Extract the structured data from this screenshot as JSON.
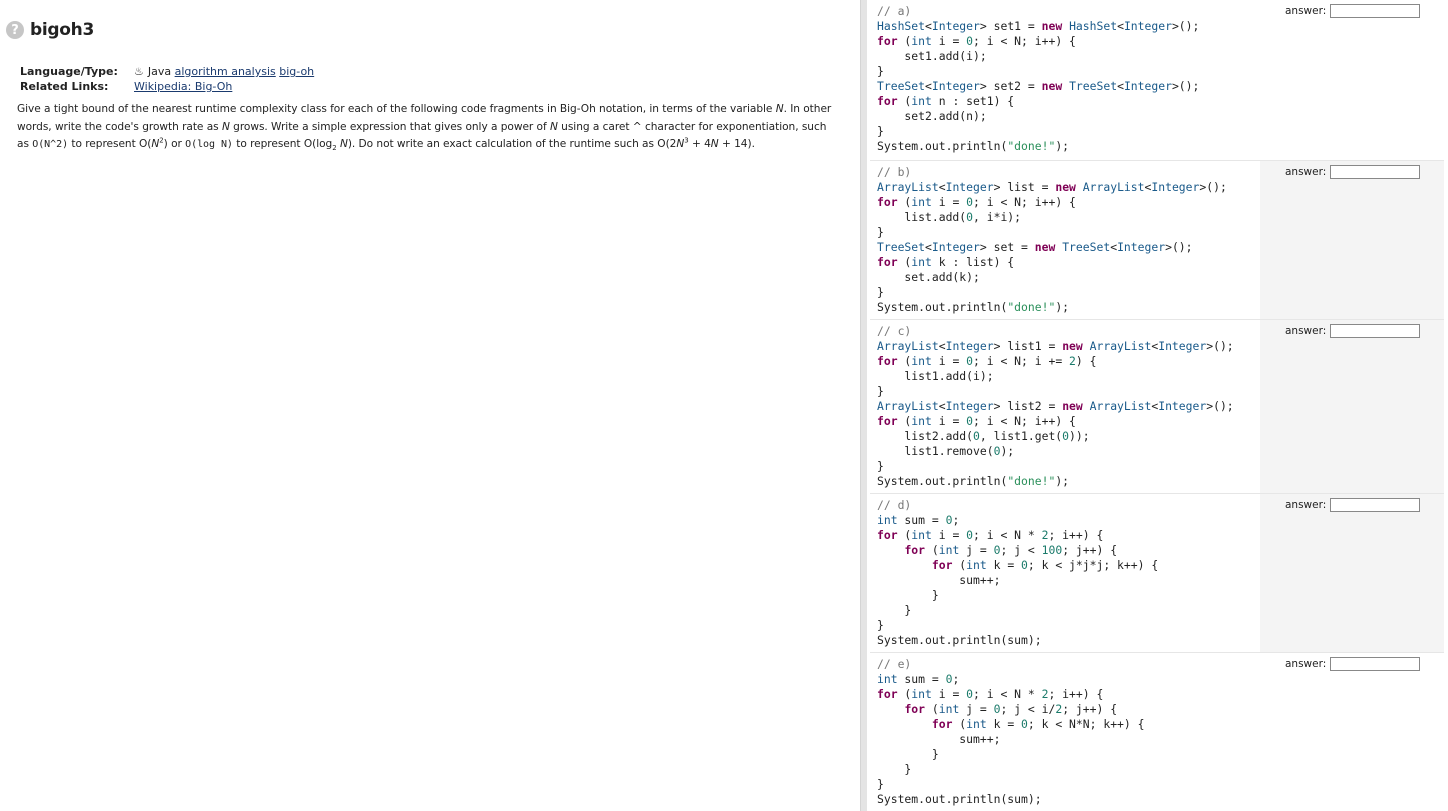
{
  "page": {
    "title": "bigoh3",
    "meta": {
      "language_label": "Language/Type:",
      "language_value": "Java",
      "tag1": "algorithm analysis",
      "tag2": "big-oh",
      "links_label": "Related Links:",
      "link1": "Wikipedia: Big-Oh"
    },
    "description": {
      "p1": "Give a tight bound of the nearest runtime complexity class for each of the following code fragments in Big-Oh notation, in terms of the variable ",
      "var_n": "N",
      "p2": ". In other words, write the code's growth rate as ",
      "p3": " grows. Write a simple expression that gives only a power of ",
      "p4": " using a caret ^ character for exponentiation, such as ",
      "code1": "O(N^2)",
      "p5": " to represent O(",
      "p6": ") or ",
      "code2": "O(log N)",
      "p7": " to represent O(log",
      "sub2": "2",
      "p8": "). Do not write an exact calculation of the runtime such as O(2",
      "p9": " + 4",
      "p10": " + 14).",
      "exp2": "2",
      "exp3": "3"
    }
  },
  "answer_label": "answer:",
  "problems": [
    {
      "label": "// a)",
      "answer": ""
    },
    {
      "label": "// b)",
      "answer": ""
    },
    {
      "label": "// c)",
      "answer": ""
    },
    {
      "label": "// d)",
      "answer": ""
    },
    {
      "label": "// e)",
      "answer": ""
    }
  ],
  "code": {
    "a": [
      "HashSet<Integer> set1 = new HashSet<Integer>();",
      "for (int i = 0; i < N; i++) {",
      "    set1.add(i);",
      "}",
      "TreeSet<Integer> set2 = new TreeSet<Integer>();",
      "for (int n : set1) {",
      "    set2.add(n);",
      "}",
      "System.out.println(\"done!\");"
    ],
    "b": [
      "ArrayList<Integer> list = new ArrayList<Integer>();",
      "for (int i = 0; i < N; i++) {",
      "    list.add(0, i*i);",
      "}",
      "TreeSet<Integer> set = new TreeSet<Integer>();",
      "for (int k : list) {",
      "    set.add(k);",
      "}",
      "System.out.println(\"done!\");"
    ],
    "c": [
      "ArrayList<Integer> list1 = new ArrayList<Integer>();",
      "for (int i = 0; i < N; i += 2) {",
      "    list1.add(i);",
      "}",
      "ArrayList<Integer> list2 = new ArrayList<Integer>();",
      "for (int i = 0; i < N; i++) {",
      "    list2.add(0, list1.get(0));",
      "    list1.remove(0);",
      "}",
      "System.out.println(\"done!\");"
    ],
    "d": [
      "int sum = 0;",
      "for (int i = 0; i < N * 2; i++) {",
      "    for (int j = 0; j < 100; j++) {",
      "        for (int k = 0; k < j*j*j; k++) {",
      "            sum++;",
      "        }",
      "    }",
      "}",
      "System.out.println(sum);"
    ],
    "e": [
      "int sum = 0;",
      "for (int i = 0; i < N * 2; i++) {",
      "    for (int j = 0; j < i/2; j++) {",
      "        for (int k = 0; k < N*N; k++) {",
      "            sum++;",
      "        }",
      "    }",
      "}",
      "System.out.println(sum);"
    ]
  }
}
